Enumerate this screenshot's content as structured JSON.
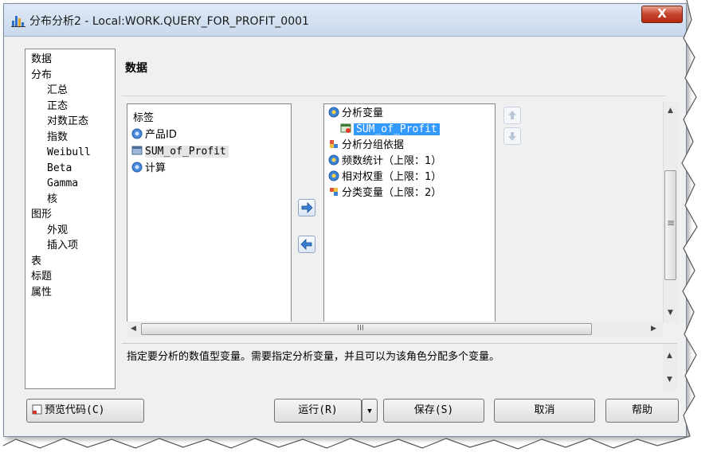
{
  "window": {
    "title": "分布分析2 - Local:WORK.QUERY_FOR_PROFIT_0001",
    "close_label": "X"
  },
  "nav": {
    "items": [
      {
        "label": "数据",
        "level": 0
      },
      {
        "label": "分布",
        "level": 0
      },
      {
        "label": "汇总",
        "level": 1
      },
      {
        "label": "正态",
        "level": 1
      },
      {
        "label": "对数正态",
        "level": 1
      },
      {
        "label": "指数",
        "level": 1
      },
      {
        "label": "Weibull",
        "level": 1
      },
      {
        "label": "Beta",
        "level": 1
      },
      {
        "label": "Gamma",
        "level": 1
      },
      {
        "label": "核",
        "level": 1
      },
      {
        "label": "图形",
        "level": 0
      },
      {
        "label": "外观",
        "level": 1
      },
      {
        "label": "插入项",
        "level": 1
      },
      {
        "label": "表",
        "level": 0
      },
      {
        "label": "标题",
        "level": 0
      },
      {
        "label": "属性",
        "level": 0
      }
    ]
  },
  "content": {
    "title": "数据"
  },
  "variables": {
    "header": "标签",
    "items": [
      {
        "label": "产品ID",
        "icon": "numeric-variable-icon"
      },
      {
        "label": "SUM_of_Profit",
        "icon": "computed-column-icon"
      },
      {
        "label": "计算",
        "icon": "numeric-variable-icon"
      }
    ]
  },
  "roles": {
    "items": [
      {
        "label": "分析变量",
        "icon": "role-analysis-icon"
      },
      {
        "label": "SUM_of_Profit",
        "icon": "computed-column-icon",
        "selected": true
      },
      {
        "label": "分析分组依据",
        "icon": "role-group-icon"
      },
      {
        "label": "频数统计（上限：1）",
        "icon": "role-frequency-icon"
      },
      {
        "label": "相对权重（上限：1）",
        "icon": "role-weight-icon"
      },
      {
        "label": "分类变量（上限：2）",
        "icon": "role-classification-icon"
      }
    ]
  },
  "scroll": {
    "hscroll_label": "III",
    "vscroll_label": "≡"
  },
  "description": "指定要分析的数值型变量。需要指定分析变量，并且可以为该角色分配多个变量。",
  "buttons": {
    "preview": "预览代码(C)",
    "run": "运行(R)",
    "save": "保存(S)",
    "cancel": "取消",
    "help": "帮助"
  },
  "colors": {
    "accent": "#3399ff",
    "close": "#c7452c"
  }
}
